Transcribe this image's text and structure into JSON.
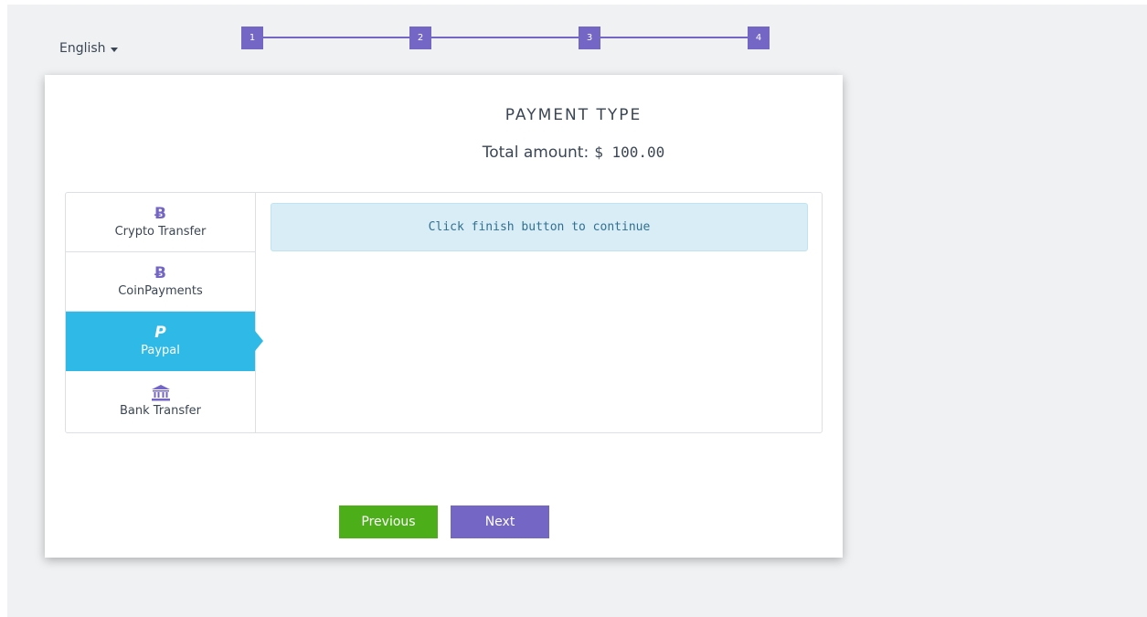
{
  "language": {
    "label": "English"
  },
  "steps": [
    "1",
    "2",
    "3",
    "4"
  ],
  "header": {
    "title": "PAYMENT TYPE",
    "total_label": "Total amount:",
    "total_value": "$ 100.00"
  },
  "payment_methods": [
    {
      "label": "Crypto Transfer",
      "icon": "bitcoin-icon",
      "glyph": "Ƀ",
      "active": false
    },
    {
      "label": "CoinPayments",
      "icon": "bitcoin-icon",
      "glyph": "Ƀ",
      "active": false
    },
    {
      "label": "Paypal",
      "icon": "paypal-icon",
      "glyph": "P",
      "active": true
    },
    {
      "label": "Bank Transfer",
      "icon": "bank-icon",
      "glyph": "",
      "active": false
    }
  ],
  "alert": {
    "text": "Click finish button to continue"
  },
  "buttons": {
    "previous": "Previous",
    "next": "Next"
  },
  "colors": {
    "accent_purple": "#7466c4",
    "active_tab": "#2fb9e6",
    "previous_button": "#4caf1a",
    "alert_bg": "#d9edf7",
    "alert_text": "#31708f"
  }
}
